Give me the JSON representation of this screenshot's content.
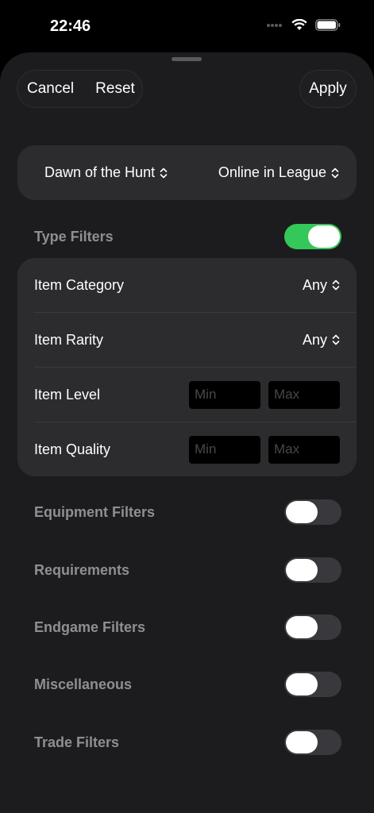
{
  "status_bar": {
    "time": "22:46"
  },
  "toolbar": {
    "cancel_label": "Cancel",
    "reset_label": "Reset",
    "apply_label": "Apply"
  },
  "league": {
    "season": "Dawn of the Hunt",
    "mode": "Online in League"
  },
  "type_filters": {
    "label": "Type Filters",
    "enabled": true,
    "accent": "#34c759",
    "rows": [
      {
        "label": "Item Category",
        "value": "Any"
      },
      {
        "label": "Item Rarity",
        "value": "Any"
      },
      {
        "label": "Item Level",
        "min_placeholder": "Min",
        "max_placeholder": "Max"
      },
      {
        "label": "Item Quality",
        "min_placeholder": "Min",
        "max_placeholder": "Max"
      }
    ]
  },
  "sections": [
    {
      "label": "Equipment Filters",
      "enabled": false
    },
    {
      "label": "Requirements",
      "enabled": false
    },
    {
      "label": "Endgame Filters",
      "enabled": false
    },
    {
      "label": "Miscellaneous",
      "enabled": false
    },
    {
      "label": "Trade Filters",
      "enabled": false
    }
  ]
}
